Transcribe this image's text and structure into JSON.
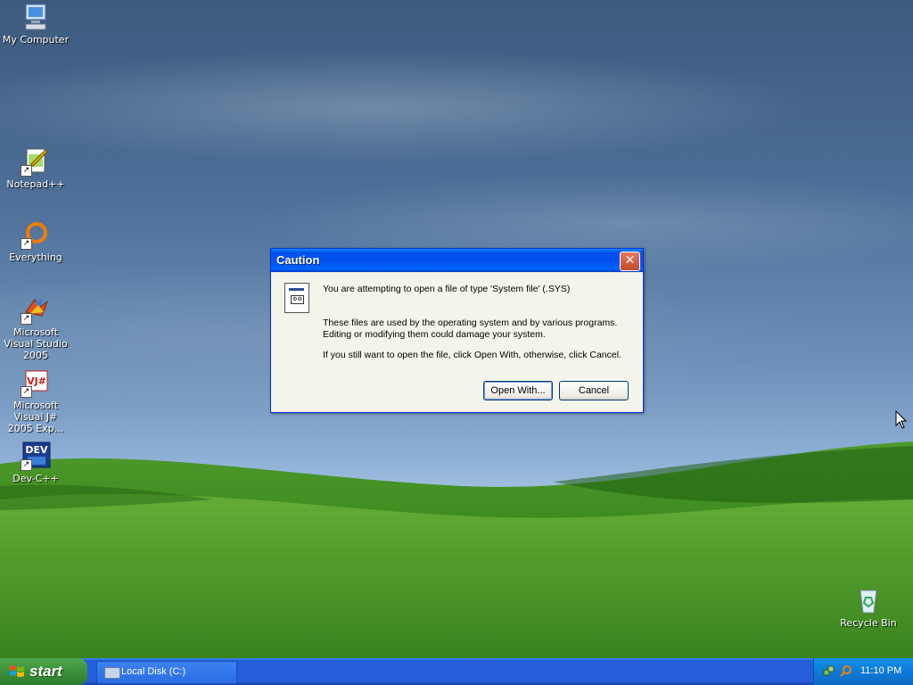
{
  "desktop": {
    "icons": [
      {
        "label": "My Computer"
      },
      {
        "label": "Notepad++"
      },
      {
        "label": "Everything"
      },
      {
        "label": "Microsoft Visual Studio 2005"
      },
      {
        "label": "Microsoft Visual J# 2005 Exp..."
      },
      {
        "label": "Dev-C++"
      },
      {
        "label": "Recycle Bin"
      }
    ]
  },
  "dialog": {
    "title": "Caution",
    "close_symbol": "✕",
    "message_1": "You are attempting to open a file of type 'System file' (.SYS)",
    "message_2": "These files are used by the operating system and by various programs. Editing or modifying them could damage your system.",
    "message_3": "If you still want to open the file, click Open With, otherwise, click Cancel.",
    "open_with_label": "Open With...",
    "cancel_label": "Cancel",
    "icon": "system-file-icon"
  },
  "taskbar": {
    "start_label": "start",
    "task_items": [
      {
        "label": "Local Disk (C:)"
      }
    ],
    "clock": "11:10 PM"
  },
  "colors": {
    "taskbar_blue": "#245edb",
    "start_green": "#3c8f3c",
    "dialog_title_blue": "#0053ee",
    "dialog_face": "#ece9d8"
  }
}
